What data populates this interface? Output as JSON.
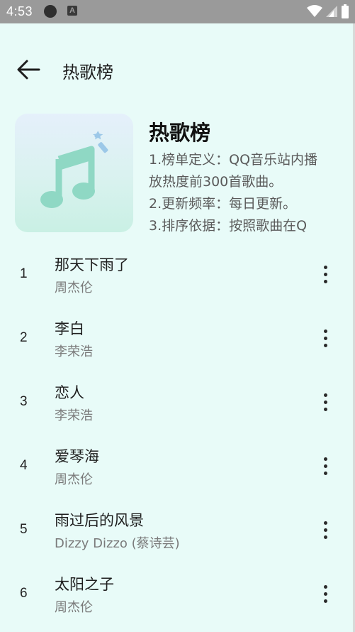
{
  "status_bar": {
    "time": "4:53",
    "notification_letter": "A",
    "icons": [
      "wifi-icon",
      "signal-icon",
      "battery-icon"
    ]
  },
  "app_bar": {
    "back_icon": "arrow-back-icon",
    "title": "热歌榜"
  },
  "playlist": {
    "cover_icon": "music-note-icon",
    "title": "热歌榜",
    "description": [
      "1.榜单定义：QQ音乐站内播",
      "放热度前300首歌曲。",
      "2.更新频率：每日更新。",
      "3.排序依据：按照歌曲在Q"
    ]
  },
  "songs": [
    {
      "rank": "1",
      "name": "那天下雨了",
      "artist": "周杰伦"
    },
    {
      "rank": "2",
      "name": "李白",
      "artist": "李荣浩"
    },
    {
      "rank": "3",
      "name": "恋人",
      "artist": "李荣浩"
    },
    {
      "rank": "4",
      "name": "爱琴海",
      "artist": "周杰伦"
    },
    {
      "rank": "5",
      "name": "雨过后的风景",
      "artist": "Dizzy Dizzo (蔡诗芸)"
    },
    {
      "rank": "6",
      "name": "太阳之子",
      "artist": "周杰伦"
    }
  ],
  "colors": {
    "background": "#e8fbf8",
    "status_bar": "#9a9a9a",
    "cover_note": "#8fd8c4"
  }
}
